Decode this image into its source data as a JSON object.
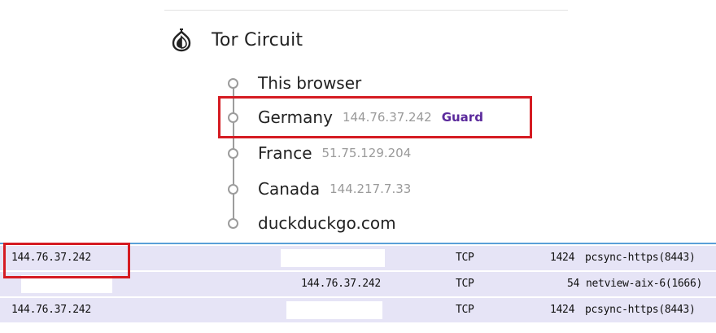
{
  "panel": {
    "title": "Tor Circuit",
    "icon": "onion-icon"
  },
  "circuit": [
    {
      "name": "This browser",
      "ip": "",
      "role": ""
    },
    {
      "name": "Germany",
      "ip": "144.76.37.242",
      "role": "Guard"
    },
    {
      "name": "France",
      "ip": "51.75.129.204",
      "role": ""
    },
    {
      "name": "Canada",
      "ip": "144.217.7.33",
      "role": ""
    },
    {
      "name": "duckduckgo.com",
      "ip": "",
      "role": ""
    }
  ],
  "packets": {
    "rows": [
      {
        "source": "144.76.37.242",
        "destination": "",
        "protocol": "TCP",
        "length": "1424",
        "info": "pcsync-https(8443)"
      },
      {
        "source": "",
        "destination": "144.76.37.242",
        "protocol": "TCP",
        "length": "54",
        "info": "netview-aix-6(1666)"
      },
      {
        "source": "144.76.37.242",
        "destination": "",
        "protocol": "TCP",
        "length": "1424",
        "info": "pcsync-https(8443)"
      }
    ]
  },
  "colors": {
    "highlight": "#d51b22",
    "guard_role": "#5b2a9c",
    "row_background": "#e6e4f6",
    "row_separator": "#5aa0d8"
  }
}
